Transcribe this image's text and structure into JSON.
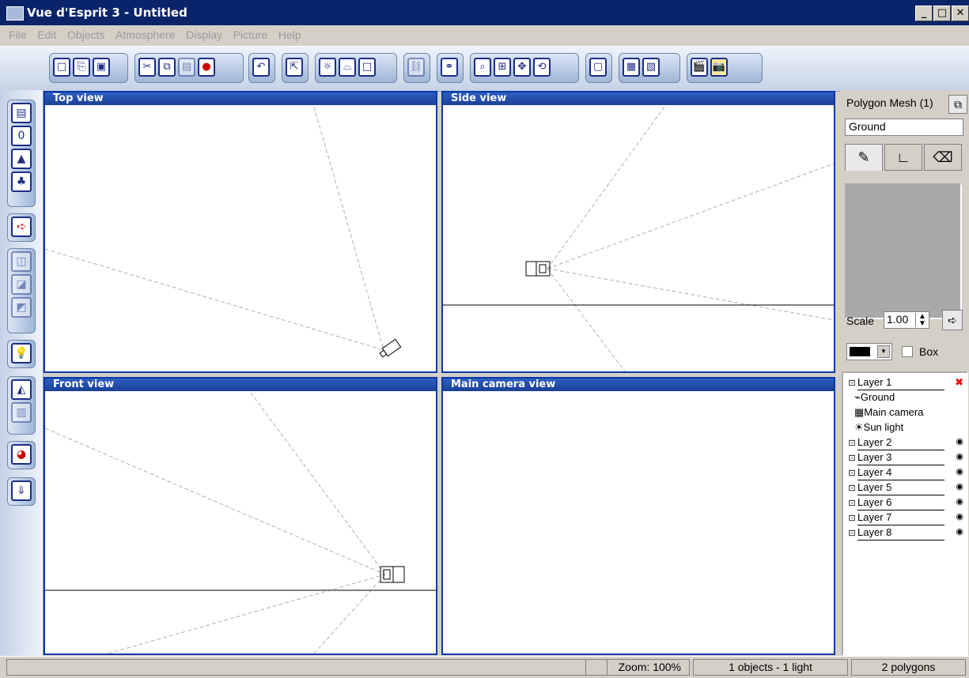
{
  "window": {
    "title": "Vue d'Esprit 3 - Untitled",
    "min_glyph": "_",
    "max_glyph": "□",
    "close_glyph": "✕"
  },
  "menu": [
    "File",
    "Edit",
    "Objects",
    "Atmosphere",
    "Display",
    "Picture",
    "Help"
  ],
  "viewports": {
    "top": "Top view",
    "side": "Side view",
    "front": "Front view",
    "camera": "Main camera view"
  },
  "panel": {
    "object_title": "Polygon Mesh (1)",
    "object_name": "Ground",
    "scale_label": "Scale",
    "scale_value": "1.00",
    "box_label": "Box"
  },
  "layers": {
    "layer1": "Layer 1",
    "children": [
      "Ground",
      "Main camera",
      "Sun light"
    ],
    "others": [
      "Layer 2",
      "Layer 3",
      "Layer 4",
      "Layer 5",
      "Layer 6",
      "Layer 7",
      "Layer 8"
    ]
  },
  "status": {
    "zoom": "Zoom: 100%",
    "objects": "1 objects - 1 light",
    "polygons": "2 polygons"
  },
  "colors": {
    "title_bar": "#0a246a",
    "viewport_border": "#0a3aa8",
    "viewport_title": "#2f5fc0"
  }
}
